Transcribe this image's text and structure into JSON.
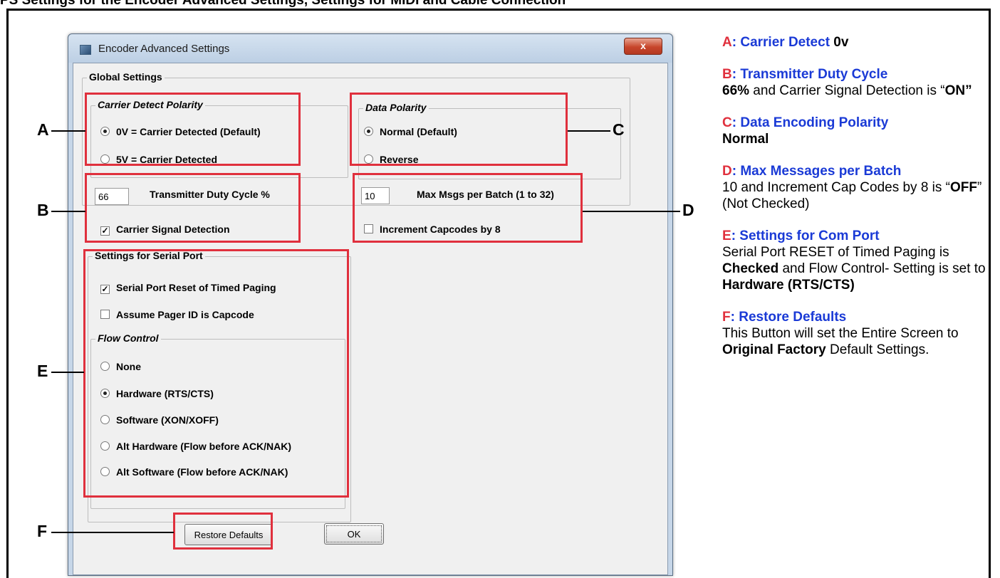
{
  "header_text": "PS Settings for the Encoder Advanced Settings, Settings for MIDI and Cable Connection",
  "window": {
    "title": "Encoder Advanced Settings",
    "close_glyph": "x"
  },
  "global_settings": {
    "label": "Global Settings",
    "carrier_detect_polarity": {
      "label": "Carrier Detect Polarity",
      "options": [
        {
          "label": "0V = Carrier Detected (Default)",
          "selected": true
        },
        {
          "label": "5V = Carrier Detected",
          "selected": false
        }
      ]
    },
    "data_polarity": {
      "label": "Data Polarity",
      "options": [
        {
          "label": "Normal (Default)",
          "selected": true
        },
        {
          "label": "Reverse",
          "selected": false
        }
      ]
    },
    "duty_cycle": {
      "value": "66",
      "label": "Transmitter Duty Cycle %"
    },
    "carrier_signal_detection": {
      "label": "Carrier Signal Detection",
      "checked": true
    },
    "max_msgs": {
      "value": "10",
      "label": "Max Msgs per Batch (1 to 32)"
    },
    "increment_capcodes": {
      "label": "Increment Capcodes by 8",
      "checked": false
    }
  },
  "serial_port": {
    "label": "Settings for Serial Port",
    "reset_timed_paging": {
      "label": "Serial Port Reset of Timed Paging",
      "checked": true
    },
    "assume_pager_id": {
      "label": "Assume Pager ID is Capcode",
      "checked": false
    },
    "flow_control": {
      "label": "Flow Control",
      "options": [
        {
          "label": "None",
          "selected": false
        },
        {
          "label": "Hardware (RTS/CTS)",
          "selected": true
        },
        {
          "label": "Software (XON/XOFF)",
          "selected": false
        },
        {
          "label": "Alt Hardware (Flow before ACK/NAK)",
          "selected": false
        },
        {
          "label": "Alt Software (Flow before ACK/NAK)",
          "selected": false
        }
      ]
    }
  },
  "buttons": {
    "restore_defaults": "Restore Defaults",
    "ok": "OK"
  },
  "callout_letters": {
    "a": "A",
    "b": "B",
    "c": "C",
    "d": "D",
    "e": "E",
    "f": "F"
  },
  "highlight_color": "#e0303d",
  "notes": {
    "a": {
      "key": "A",
      "sep": ": ",
      "title": "Carrier Detect",
      "value": " 0v"
    },
    "b": {
      "key": "B",
      "sep": ": ",
      "title": "Transmitter Duty Cycle",
      "line2_bold": "66%",
      "line2_rest": " and Carrier Signal Detection is “",
      "on": "ON”"
    },
    "c": {
      "key": "C",
      "sep": ": ",
      "title": "Data Encoding Polarity",
      "value": "Normal"
    },
    "d": {
      "key": "D",
      "sep": ": ",
      "title": "Max Messages per Batch",
      "text1": "10 and Increment Cap Codes by 8 is “",
      "off": "OFF",
      "text2": "” (Not Checked)"
    },
    "e": {
      "key": "E",
      "sep": ": ",
      "title": "Settings for Com Port",
      "text1": "Serial Port RESET of Timed Paging is ",
      "checked": "Checked",
      "text2": " and Flow Control- Setting is set to ",
      "hw": "Hardware (RTS/CTS)"
    },
    "f": {
      "key": "F",
      "sep": ": ",
      "title": "Restore Defaults",
      "text1": "This Button will set the Entire Screen to ",
      "factory": "Original Factory",
      "text2": " Default Settings."
    }
  }
}
